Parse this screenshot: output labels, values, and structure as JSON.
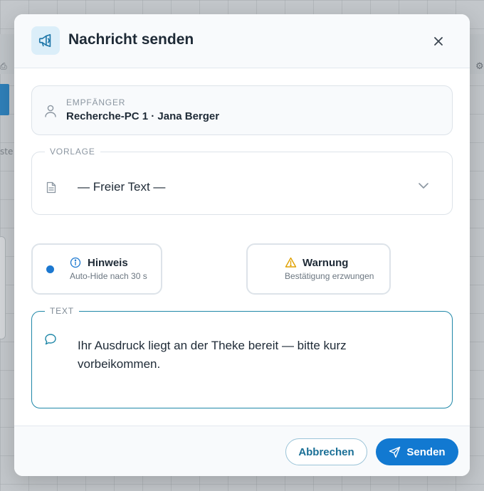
{
  "dialog": {
    "title": "Nachricht senden",
    "header_icon": "megaphone-icon",
    "close_icon": "close-icon"
  },
  "recipient": {
    "label": "EMPFÄNGER",
    "value": "Recherche-PC 1 · Jana Berger",
    "icon": "user-icon"
  },
  "template": {
    "label": "VORLAGE",
    "selected": "— Freier Text —",
    "icon": "document-icon"
  },
  "message_types": [
    {
      "title": "Hinweis",
      "subtitle": "Auto-Hide nach 30 s",
      "icon": "info-icon",
      "selected": true
    },
    {
      "title": "Warnung",
      "subtitle": "Bestätigung erzwungen",
      "icon": "warning-icon",
      "selected": false
    }
  ],
  "text": {
    "label": "TEXT",
    "value": "Ihr Ausdruck liegt an der Theke bereit — bitte kurz vorbeikommen.",
    "icon": "chat-bubble-icon"
  },
  "footer": {
    "cancel_label": "Abbrechen",
    "send_label": "Senden",
    "send_icon": "paper-plane-icon"
  },
  "background": {
    "partial_text": "ster"
  },
  "colors": {
    "accent": "#1279d1",
    "focus_border": "#1f87a8",
    "warning": "#e0a100"
  }
}
